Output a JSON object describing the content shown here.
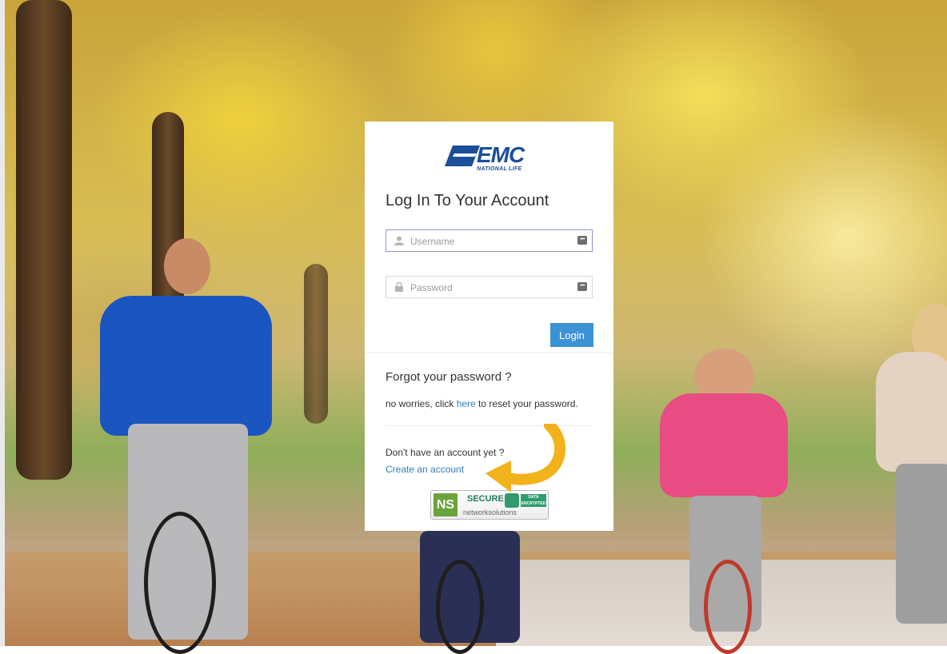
{
  "logo": {
    "brand": "EMC",
    "subtitle": "NATIONAL LIFE"
  },
  "login": {
    "title": "Log In To Your Account",
    "username_placeholder": "Username",
    "password_placeholder": "Password",
    "login_label": "Login"
  },
  "forgot": {
    "title": "Forgot your password ?",
    "text_before": "no worries, click ",
    "link": "here",
    "text_after": " to reset your password."
  },
  "signup": {
    "question": "Don't have an account yet ?",
    "link": "Create an account"
  },
  "badge": {
    "logo": "NS",
    "secure": "SECURE",
    "data_encrypted": "DATA ENCRYPTED",
    "provider": "networksolutions"
  },
  "colors": {
    "accent": "#3b93d6",
    "brand": "#1d4e9a",
    "link": "#2f7fc2",
    "arrow": "#f2b21b"
  }
}
